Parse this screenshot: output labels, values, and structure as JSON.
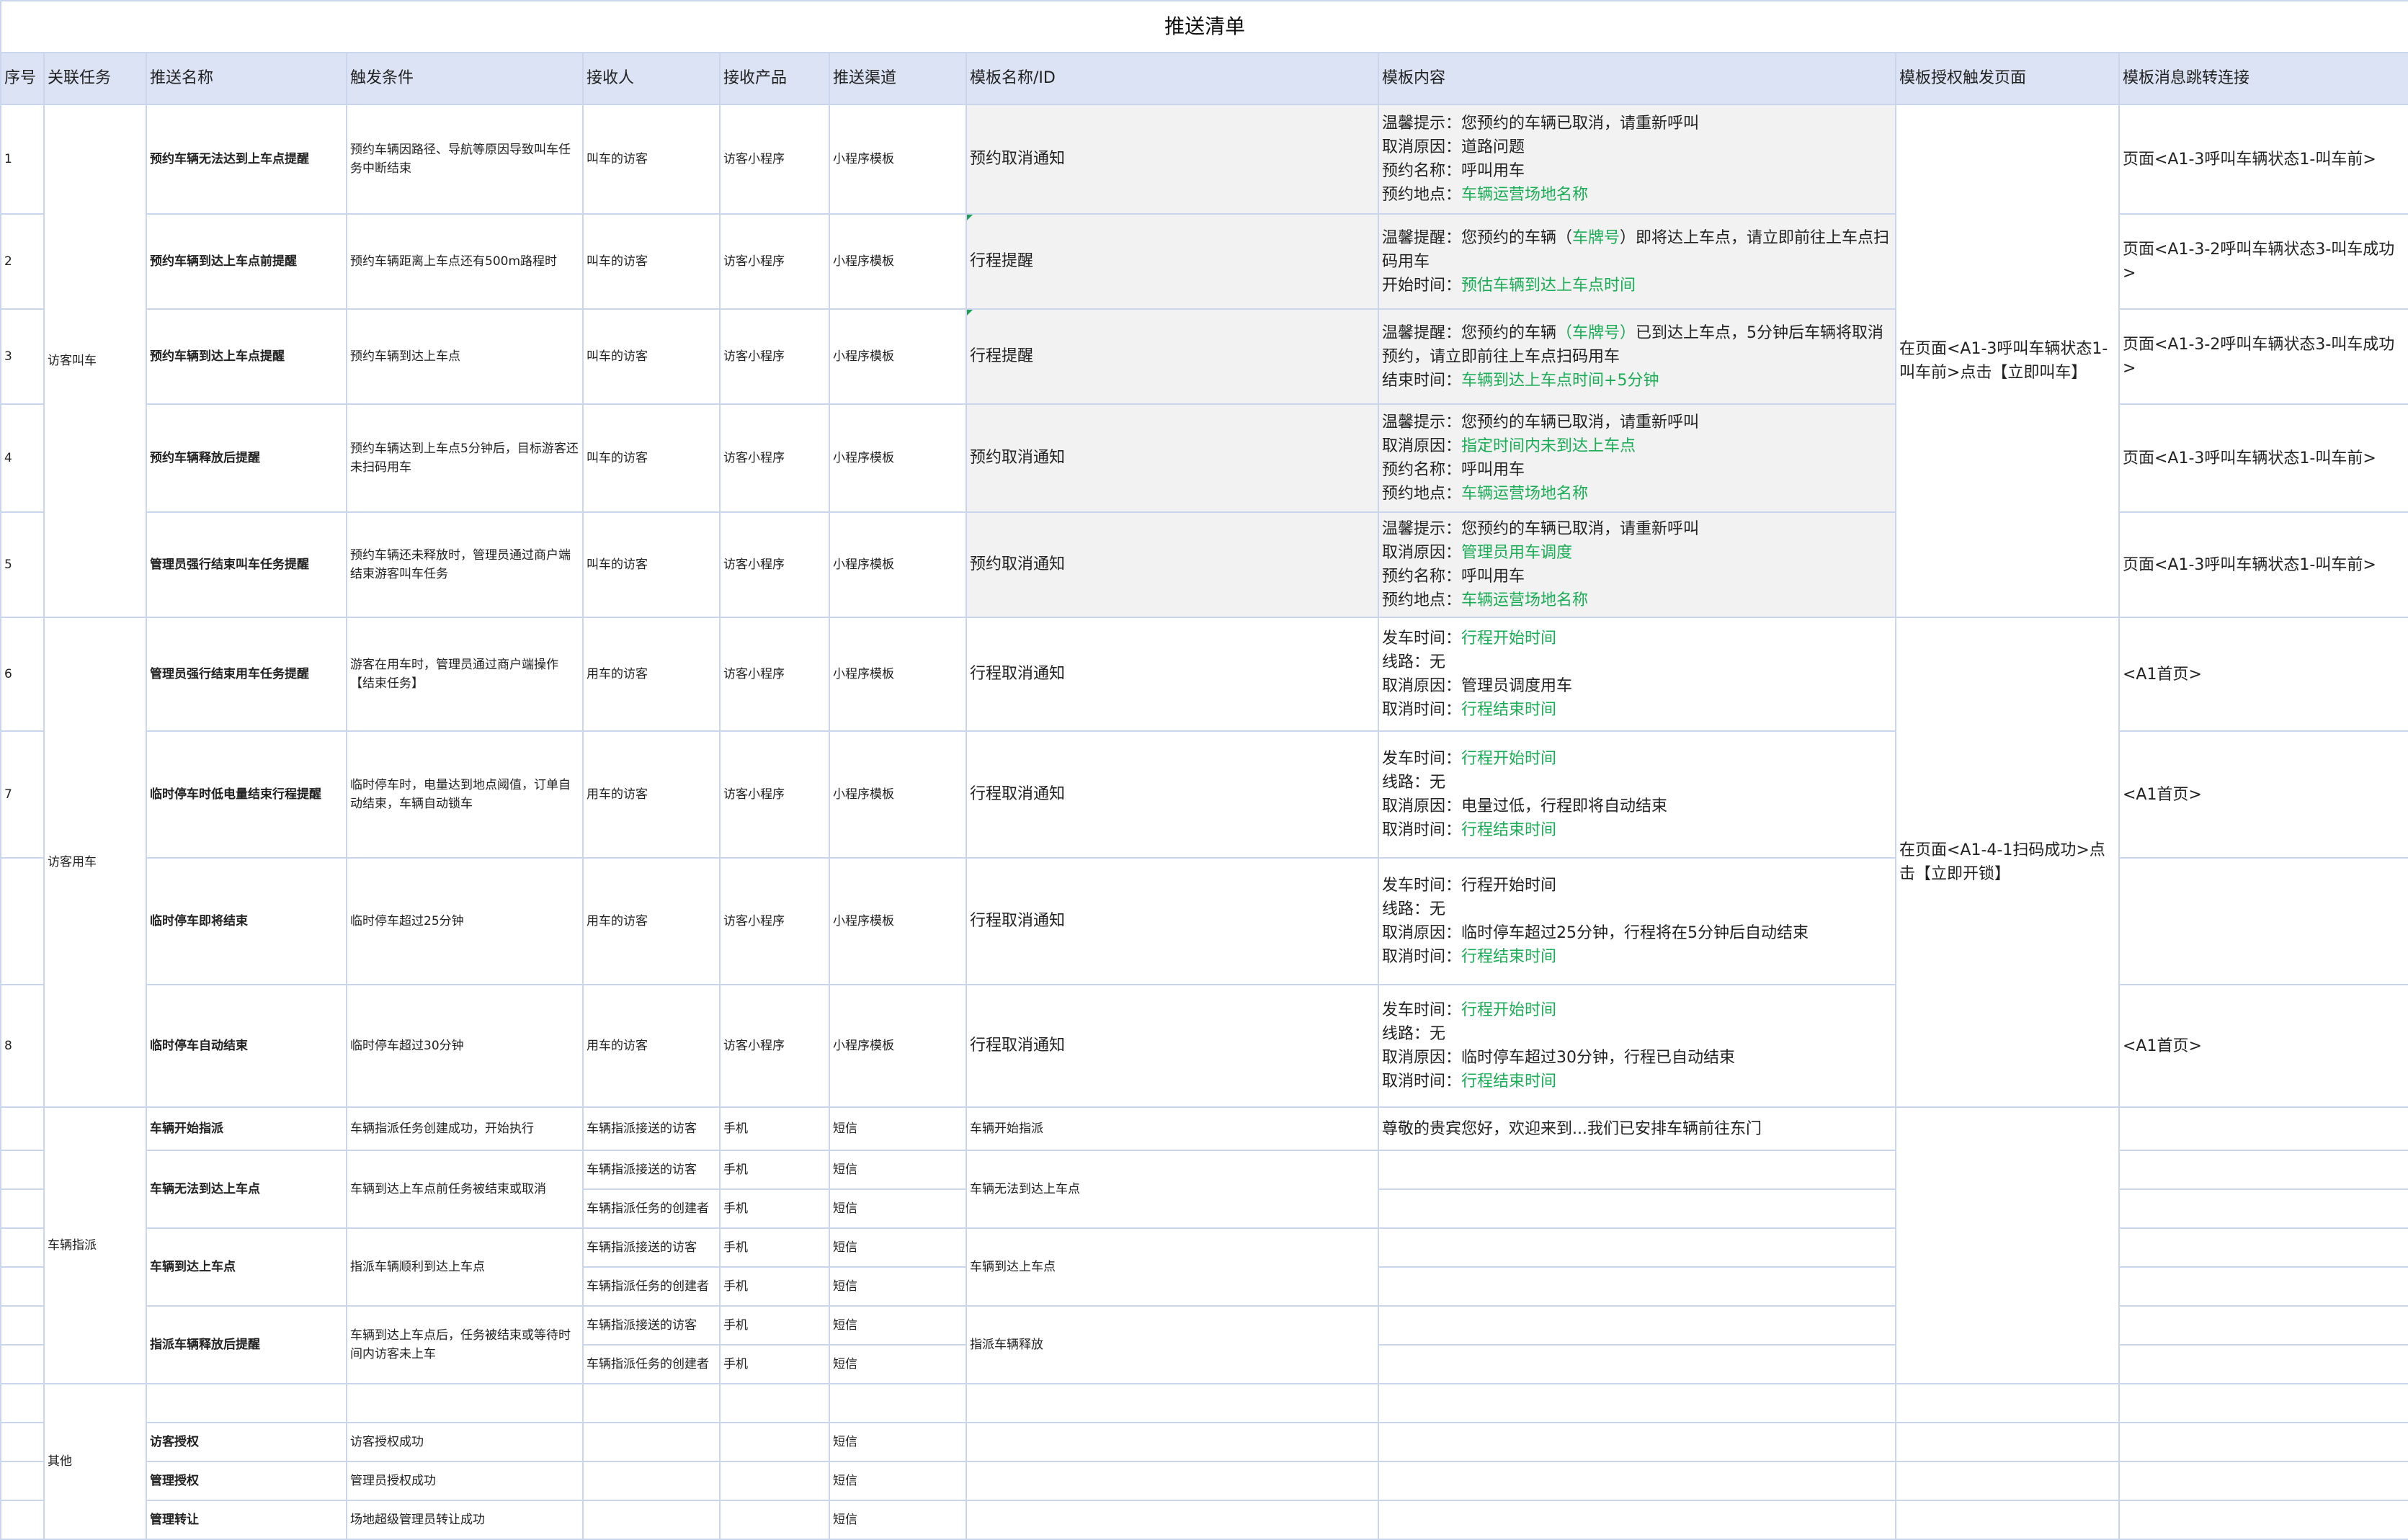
{
  "title": "推送清单",
  "headers": [
    "序号",
    "关联任务",
    "推送名称",
    "触发条件",
    "接收人",
    "接收产品",
    "推送渠道",
    "模板名称/ID",
    "模板内容",
    "模板授权触发页面",
    "模板消息跳转连接"
  ],
  "tasks": {
    "t1": "访客叫车",
    "t2": "访客用车",
    "t3": "车辆指派",
    "t4": "其他"
  },
  "auth": {
    "a1": "在页面<A1-3呼叫车辆状态1-叫车前>点击【立即叫车】",
    "a2": "在页面<A1-4-1扫码成功>点击【立即开锁】"
  },
  "rows": [
    {
      "seq": "1",
      "name": "预约车辆无法达到上车点提醒",
      "trigger": "预约车辆因路径、导航等原因导致叫车任务中断结束",
      "receiver": "叫车的访客",
      "product": "访客小程序",
      "channel": "小程序模板",
      "tpl": "预约取消通知",
      "content": [
        {
          "k": "温馨提示：",
          "v": "您预约的车辆已取消，请重新呼叫",
          "g": false
        },
        {
          "k": "取消原因：",
          "v": "道路问题",
          "g": false
        },
        {
          "k": "预约名称：",
          "v": "呼叫用车",
          "g": false
        },
        {
          "k": "预约地点：",
          "v": "车辆运营场地名称",
          "g": true
        }
      ],
      "jump": "页面<A1-3呼叫车辆状态1-叫车前>"
    },
    {
      "seq": "2",
      "name": "预约车辆到达上车点前提醒",
      "trigger": "预约车辆距离上车点还有500m路程时",
      "receiver": "叫车的访客",
      "product": "访客小程序",
      "channel": "小程序模板",
      "tpl": "行程提醒",
      "c_a": "温馨提醒：您预约的车辆（",
      "c_b": "车牌号",
      "c_c": "）即将达上车点，请立即前往上车点扫码用车",
      "c_d": "开始时间：",
      "c_e": "预估车辆到达上车点时间",
      "jump": "页面<A1-3-2呼叫车辆状态3-叫车成功>"
    },
    {
      "seq": "3",
      "name": "预约车辆到达上车点提醒",
      "trigger": "预约车辆到达上车点",
      "receiver": "叫车的访客",
      "product": "访客小程序",
      "channel": "小程序模板",
      "tpl": "行程提醒",
      "c_a": "温馨提醒：您预约的车辆",
      "c_b": "（车牌号）",
      "c_c": "已到达上车点，5分钟后车辆将取消预约，请立即前往上车点扫码用车",
      "c_d": "结束时间：",
      "c_e": "车辆到达上车点时间+5分钟",
      "jump": "页面<A1-3-2呼叫车辆状态3-叫车成功>"
    },
    {
      "seq": "4",
      "name": "预约车辆释放后提醒",
      "trigger": "预约车辆达到上车点5分钟后，目标游客还未扫码用车",
      "receiver": "叫车的访客",
      "product": "访客小程序",
      "channel": "小程序模板",
      "tpl": "预约取消通知",
      "content": [
        {
          "k": "温馨提示：",
          "v": "您预约的车辆已取消，请重新呼叫",
          "g": false
        },
        {
          "k": "取消原因：",
          "v": "指定时间内未到达上车点",
          "g": true
        },
        {
          "k": "预约名称：",
          "v": "呼叫用车",
          "g": false
        },
        {
          "k": "预约地点：",
          "v": "车辆运营场地名称",
          "g": true
        }
      ],
      "jump": "页面<A1-3呼叫车辆状态1-叫车前>"
    },
    {
      "seq": "5",
      "name": "管理员强行结束叫车任务提醒",
      "trigger": "预约车辆还未释放时，管理员通过商户端结束游客叫车任务",
      "receiver": "叫车的访客",
      "product": "访客小程序",
      "channel": "小程序模板",
      "tpl": "预约取消通知",
      "content": [
        {
          "k": "温馨提示：",
          "v": "您预约的车辆已取消，请重新呼叫",
          "g": false
        },
        {
          "k": "取消原因：",
          "v": "管理员用车调度",
          "g": true
        },
        {
          "k": "预约名称：",
          "v": "呼叫用车",
          "g": false
        },
        {
          "k": "预约地点：",
          "v": "车辆运营场地名称",
          "g": true
        }
      ],
      "jump": "页面<A1-3呼叫车辆状态1-叫车前>"
    },
    {
      "seq": "6",
      "name": "管理员强行结束用车任务提醒",
      "trigger": "游客在用车时，管理员通过商户端操作【结束任务】",
      "receiver": "用车的访客",
      "product": "访客小程序",
      "channel": "小程序模板",
      "tpl": "行程取消通知",
      "content": [
        {
          "k": "发车时间：",
          "v": "行程开始时间",
          "g": true
        },
        {
          "k": "线路：",
          "v": "无",
          "g": false
        },
        {
          "k": "取消原因：",
          "v": "管理员调度用车",
          "g": false
        },
        {
          "k": "取消时间：",
          "v": "行程结束时间",
          "g": true
        }
      ],
      "jump": "<A1首页>"
    },
    {
      "seq": "7",
      "name": "临时停车时低电量结束行程提醒",
      "trigger": "临时停车时，电量达到地点阈值，订单自动结束，车辆自动锁车",
      "receiver": "用车的访客",
      "product": "访客小程序",
      "channel": "小程序模板",
      "tpl": "行程取消通知",
      "content": [
        {
          "k": "发车时间：",
          "v": "行程开始时间",
          "g": true
        },
        {
          "k": "线路：",
          "v": "无",
          "g": false
        },
        {
          "k": "取消原因：",
          "v": "电量过低，行程即将自动结束",
          "g": false
        },
        {
          "k": "取消时间：",
          "v": "行程结束时间",
          "g": true
        }
      ],
      "jump": "<A1首页>"
    },
    {
      "seq": "",
      "name": "临时停车即将结束",
      "trigger": "临时停车超过25分钟",
      "receiver": "用车的访客",
      "product": "访客小程序",
      "channel": "小程序模板",
      "tpl": "行程取消通知",
      "content": [
        {
          "k": "发车时间：",
          "v": "行程开始时间",
          "g": false
        },
        {
          "k": "线路：",
          "v": "无",
          "g": false
        },
        {
          "k": "取消原因：",
          "v": "临时停车超过25分钟，行程将在5分钟后自动结束",
          "g": false
        },
        {
          "k": "取消时间：",
          "v": "行程结束时间",
          "g": true
        }
      ],
      "jump": ""
    },
    {
      "seq": "8",
      "name": "临时停车自动结束",
      "trigger": "临时停车超过30分钟",
      "receiver": "用车的访客",
      "product": "访客小程序",
      "channel": "小程序模板",
      "tpl": "行程取消通知",
      "content": [
        {
          "k": "发车时间：",
          "v": "行程开始时间",
          "g": true
        },
        {
          "k": "线路：",
          "v": "无",
          "g": false
        },
        {
          "k": "取消原因：",
          "v": "临时停车超过30分钟，行程已自动结束",
          "g": false
        },
        {
          "k": "取消时间：",
          "v": "行程结束时间",
          "g": true
        }
      ],
      "jump": "<A1首页>"
    }
  ],
  "dispatch": {
    "r1": {
      "name": "车辆开始指派",
      "trigger": "车辆指派任务创建成功，开始执行",
      "receiver": "车辆指派接送的访客",
      "product": "手机",
      "channel": "短信",
      "tpl": "车辆开始指派",
      "content": "尊敬的贵宾您好，欢迎来到...我们已安排车辆前往东门"
    },
    "r2": {
      "name": "车辆无法到达上车点",
      "trigger": "车辆到达上车点前任务被结束或取消",
      "receiver_a": "车辆指派接送的访客",
      "receiver_b": "车辆指派任务的创建者",
      "product": "手机",
      "channel": "短信",
      "tpl": "车辆无法到达上车点"
    },
    "r3": {
      "name": "车辆到达上车点",
      "trigger": "指派车辆顺利到达上车点",
      "receiver_a": "车辆指派接送的访客",
      "receiver_b": "车辆指派任务的创建者",
      "product": "手机",
      "channel": "短信",
      "tpl": "车辆到达上车点"
    },
    "r4": {
      "name": "指派车辆释放后提醒",
      "trigger": "车辆到达上车点后，任务被结束或等待时间内访客未上车",
      "receiver_a": "车辆指派接送的访客",
      "receiver_b": "车辆指派任务的创建者",
      "product": "手机",
      "channel": "短信",
      "tpl": "指派车辆释放"
    }
  },
  "other": [
    {
      "name": "访客授权",
      "trigger": "访客授权成功",
      "channel": "短信"
    },
    {
      "name": "管理授权",
      "trigger": "管理员授权成功",
      "channel": "短信"
    },
    {
      "name": "管理转让",
      "trigger": "场地超级管理员转让成功",
      "channel": "短信"
    }
  ]
}
